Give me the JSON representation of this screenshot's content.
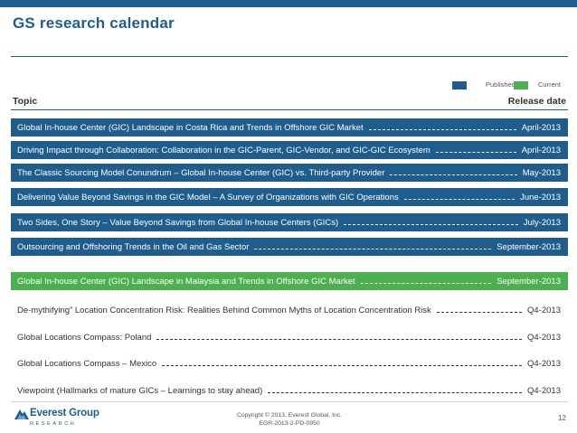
{
  "title": "GS research calendar",
  "legend": {
    "published_label": "Published",
    "current_label": "Current",
    "published_color": "#1f5d8f",
    "current_color": "#4caf50"
  },
  "columns": {
    "topic": "Topic",
    "release": "Release date"
  },
  "rows": [
    {
      "topic": "Global In-house Center (GIC) Landscape in Costa Rica and Trends in Offshore GIC Market",
      "date": "April-2013",
      "status": "published"
    },
    {
      "topic": "Driving Impact through Collaboration: Collaboration in the GIC-Parent, GIC-Vendor, and GIC-GIC Ecosystem",
      "date": "April-2013",
      "status": "published"
    },
    {
      "topic": "The Classic Sourcing Model Conundrum – Global In-house Center (GIC) vs. Third-party Provider",
      "date": "May-2013",
      "status": "published"
    },
    {
      "topic": "Delivering Value Beyond Savings in the GIC Model – A Survey of Organizations with GIC Operations",
      "date": "June-2013",
      "status": "published"
    },
    {
      "topic": "Two Sides, One Story – Value Beyond Savings from Global In-house Centers (GICs)",
      "date": "July-2013",
      "status": "published"
    },
    {
      "topic": "Outsourcing and Offshoring Trends in the Oil and Gas Sector",
      "date": "September-2013",
      "status": "published"
    },
    {
      "topic": "Global In-house Center (GIC) Landscape in Malaysia and Trends in Offshore GIC Market",
      "date": "September-2013",
      "status": "current"
    },
    {
      "topic": "De-mythifying” Location Concentration Risk: Realities Behind Common Myths of Location Concentration Risk",
      "date": "Q4-2013",
      "status": "upcoming"
    },
    {
      "topic": "Global Locations Compass: Poland",
      "date": "Q4-2013",
      "status": "upcoming"
    },
    {
      "topic": "Global Locations Compass – Mexico",
      "date": "Q4-2013",
      "status": "upcoming"
    },
    {
      "topic": "Viewpoint (Hallmarks of mature GICs – Learnings to stay ahead)",
      "date": "Q4-2013",
      "status": "upcoming"
    }
  ],
  "footer": {
    "logo_name": "Everest Group",
    "logo_sub": "RESEARCH",
    "copyright": "Copyright © 2013, Everest Global, Inc.",
    "code": "EGR-2013-2-PD-0950",
    "page": "12"
  }
}
